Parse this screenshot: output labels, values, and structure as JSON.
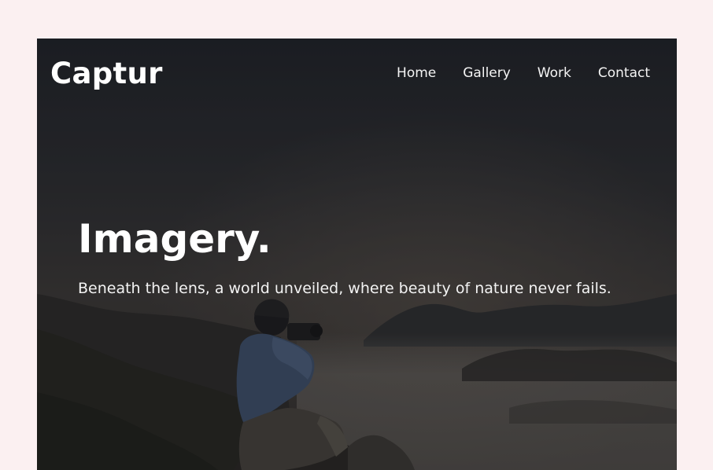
{
  "site": {
    "brand": "Captur"
  },
  "nav": {
    "items": [
      {
        "label": "Home"
      },
      {
        "label": "Gallery"
      },
      {
        "label": "Work"
      },
      {
        "label": "Contact"
      }
    ]
  },
  "hero": {
    "headline": "Imagery.",
    "tagline": "Beneath the lens, a world unveiled, where beauty of nature never fails.",
    "background": "mountain-photographer-photo"
  },
  "colors": {
    "page_background": "#fbf0f1",
    "hero_overlay": "#1e2026",
    "text": "#ffffff"
  }
}
